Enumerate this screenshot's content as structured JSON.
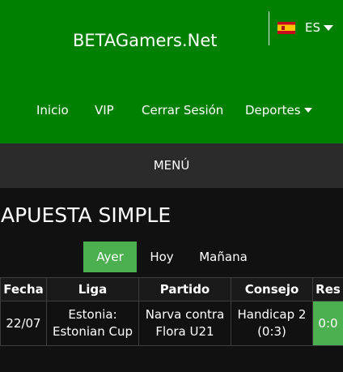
{
  "header": {
    "brand": "BETAGamers.Net",
    "language": "ES"
  },
  "nav": {
    "items": [
      {
        "label": "Inicio"
      },
      {
        "label": "VIP"
      },
      {
        "label": "Cerrar Sesión"
      },
      {
        "label": "Deportes"
      }
    ]
  },
  "menu": {
    "label": "MENÚ"
  },
  "page": {
    "title": "APUESTA SIMPLE"
  },
  "tabs": {
    "items": [
      {
        "label": "Ayer",
        "active": true
      },
      {
        "label": "Hoy",
        "active": false
      },
      {
        "label": "Mañana",
        "active": false
      }
    ]
  },
  "table": {
    "headers": [
      "Fecha",
      "Liga",
      "Partido",
      "Consejo",
      "Res"
    ],
    "rows": [
      {
        "fecha": "22/07",
        "liga": [
          "Estonia:",
          "Estonian Cup"
        ],
        "partido": [
          "Narva contra",
          "Flora U21"
        ],
        "consejo": [
          "Handicap 2",
          "(0:3)"
        ],
        "res": "0:0"
      }
    ]
  },
  "colors": {
    "header_bg": "#008000",
    "menu_bg": "#2b2b2b",
    "page_bg": "#111111",
    "accent": "#4caf50",
    "text": "#ffffff"
  },
  "icons": {
    "flag": "spain-flag-icon",
    "language_caret": "caret-down-icon",
    "deportes_caret": "caret-down-icon"
  }
}
